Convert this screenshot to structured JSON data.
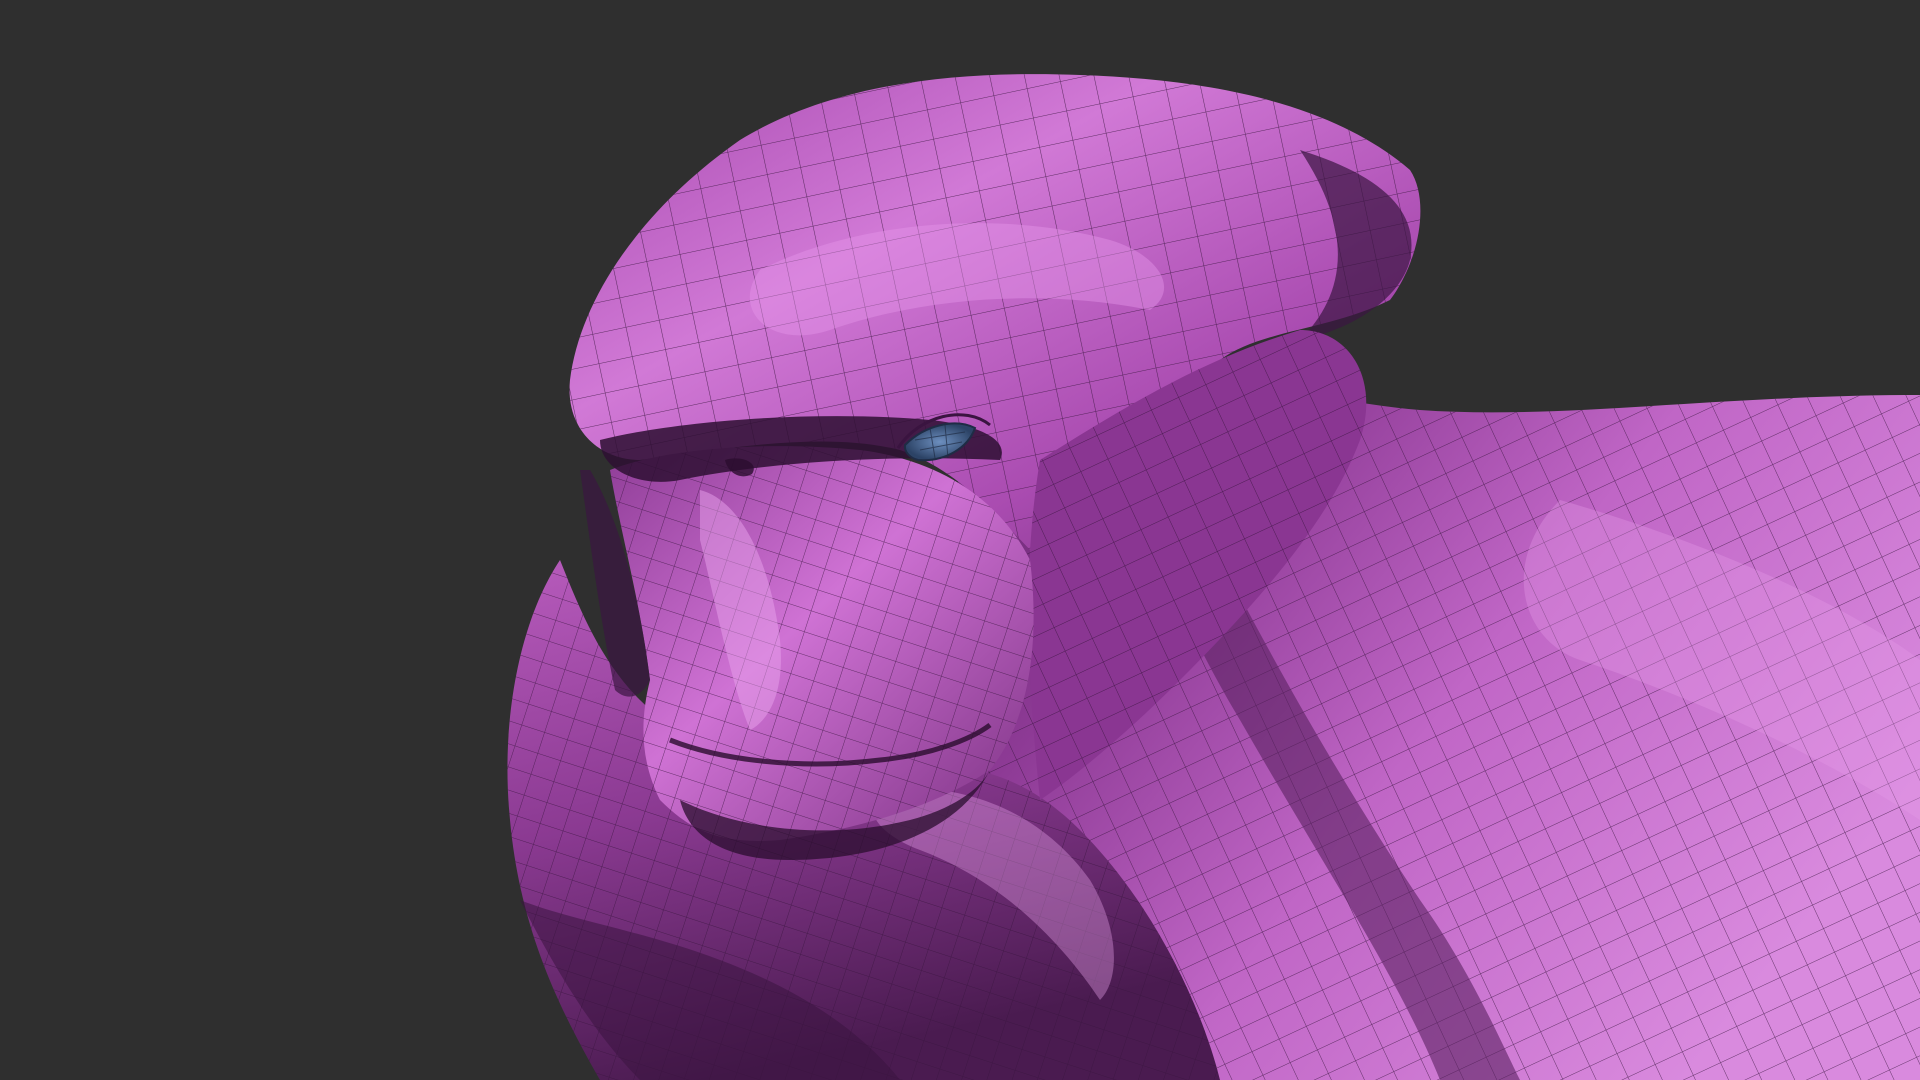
{
  "viewport": {
    "background_color": "#2f2f2f",
    "subject": "mesh-sculpt",
    "display_mode": "wireframe-on-shaded"
  },
  "model": {
    "base_color": "#b150b5",
    "highlight_color": "#d97ddc",
    "shadow_color": "#4a1c4f",
    "deep_shadow_color": "#2a0d2e",
    "wire_color": "#3a1640",
    "eye_color": "#3d5a86",
    "eye_icon": "eye-shape"
  }
}
